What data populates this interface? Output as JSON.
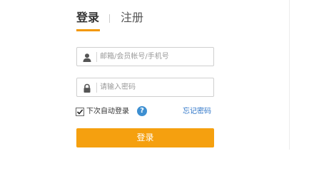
{
  "tabs": {
    "login_label": "登录",
    "register_label": "注册",
    "active": "login"
  },
  "form": {
    "username": {
      "icon": "user-icon",
      "placeholder": "邮箱/会员帐号/手机号",
      "value": ""
    },
    "password": {
      "icon": "lock-icon",
      "placeholder": "请输入密码",
      "value": ""
    },
    "remember": {
      "label": "下次自动登录",
      "checked": true,
      "help_icon": "question-icon",
      "help_glyph": "?"
    },
    "forgot_label": "忘记密码",
    "submit_label": "登录"
  },
  "colors": {
    "accent": "#f39800",
    "button": "#f5a00f",
    "link": "#2e75c8",
    "help": "#3d8fd1"
  }
}
